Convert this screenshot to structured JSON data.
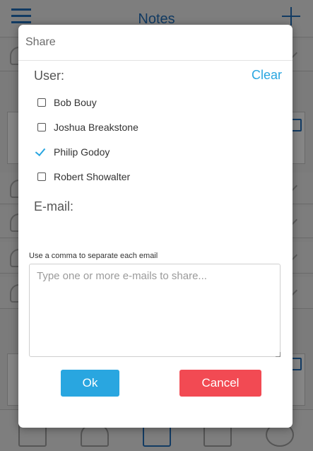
{
  "app": {
    "title": "Notes"
  },
  "modal": {
    "title": "Share",
    "user_label": "User:",
    "clear_label": "Clear",
    "users": [
      {
        "name": "Bob Bouy",
        "checked": false
      },
      {
        "name": "Joshua Breakstone",
        "checked": false
      },
      {
        "name": "Philip Godoy",
        "checked": true
      },
      {
        "name": "Robert Showalter",
        "checked": false
      }
    ],
    "email_label": "E-mail:",
    "email_hint": "Use a comma to separate each email",
    "email_placeholder": "Type one or more e-mails to share...",
    "email_value": "",
    "ok_label": "Ok",
    "cancel_label": "Cancel"
  },
  "colors": {
    "accent": "#29a6e0",
    "danger": "#f24a53",
    "app_nav": "#123b63"
  }
}
